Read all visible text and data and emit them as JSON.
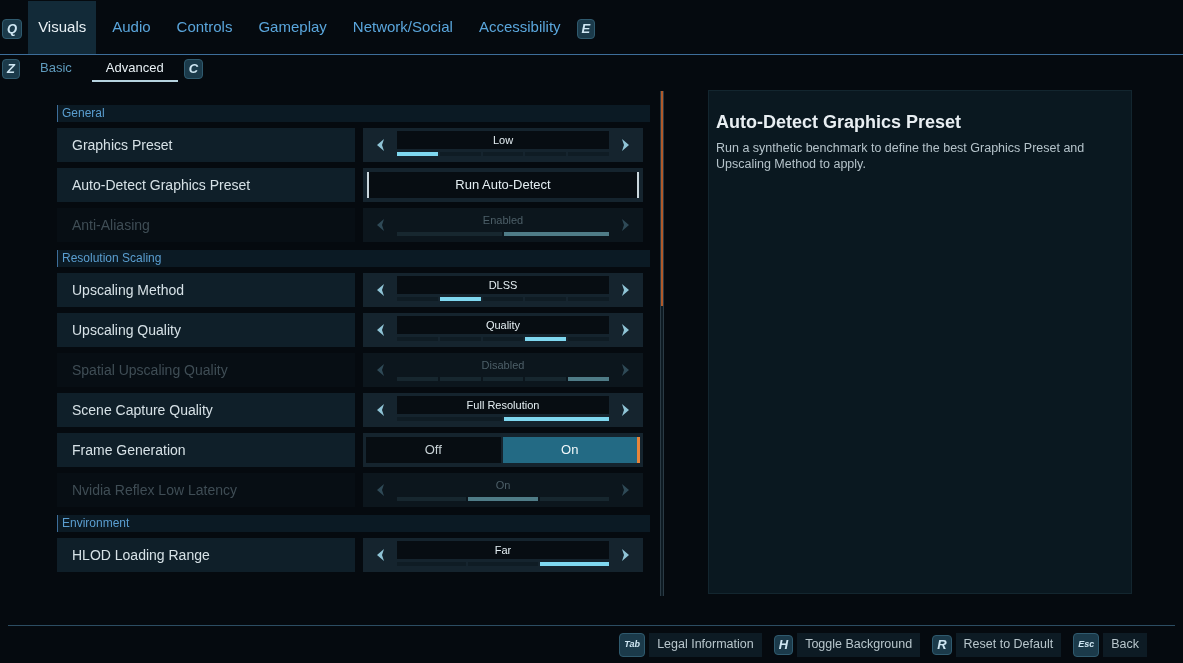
{
  "tabs_key_left": "Q",
  "tabs": [
    {
      "label": "Visuals",
      "selected": true
    },
    {
      "label": "Audio",
      "selected": false
    },
    {
      "label": "Controls",
      "selected": false
    },
    {
      "label": "Gameplay",
      "selected": false
    },
    {
      "label": "Network/Social",
      "selected": false
    },
    {
      "label": "Accessibility",
      "selected": false
    }
  ],
  "tabs_key_right": "E",
  "subtabs_key_left": "Z",
  "subtabs": [
    {
      "label": "Basic",
      "selected": false
    },
    {
      "label": "Advanced",
      "selected": true
    }
  ],
  "subtabs_key_right": "C",
  "sections": [
    {
      "title": "General",
      "settings": [
        {
          "kind": "selector",
          "label": "Graphics Preset",
          "value": "Low",
          "segments": [
            {
              "selected": true
            },
            {
              "selected": false
            },
            {
              "selected": false
            },
            {
              "selected": false
            },
            {
              "selected": false
            }
          ],
          "disabled": false
        },
        {
          "kind": "button",
          "label": "Auto-Detect Graphics Preset",
          "value": "Run Auto-Detect",
          "disabled": false
        },
        {
          "kind": "selector",
          "label": "Anti-Aliasing",
          "value": "Enabled",
          "segments": [
            {
              "selected": false
            },
            {
              "selected": true
            }
          ],
          "disabled": true
        }
      ]
    },
    {
      "title": "Resolution Scaling",
      "settings": [
        {
          "kind": "selector",
          "label": "Upscaling Method",
          "value": "DLSS",
          "segments": [
            {
              "selected": false
            },
            {
              "selected": true
            },
            {
              "selected": false
            },
            {
              "selected": false
            },
            {
              "selected": false
            }
          ],
          "disabled": false
        },
        {
          "kind": "selector",
          "label": "Upscaling Quality",
          "value": "Quality",
          "segments": [
            {
              "selected": false
            },
            {
              "selected": false
            },
            {
              "selected": false
            },
            {
              "selected": true
            },
            {
              "selected": false
            }
          ],
          "disabled": false
        },
        {
          "kind": "selector",
          "label": "Spatial Upscaling Quality",
          "value": "Disabled",
          "segments": [
            {
              "selected": false
            },
            {
              "selected": false
            },
            {
              "selected": false
            },
            {
              "selected": false
            },
            {
              "selected": true
            }
          ],
          "disabled": true
        },
        {
          "kind": "selector",
          "label": "Scene Capture Quality",
          "value": "Full Resolution",
          "segments": [
            {
              "selected": false
            },
            {
              "selected": true
            }
          ],
          "disabled": false
        },
        {
          "kind": "toggle",
          "label": "Frame Generation",
          "options": [
            {
              "label": "Off",
              "selected": false
            },
            {
              "label": "On",
              "selected": true
            }
          ],
          "disabled": false
        },
        {
          "kind": "selector",
          "label": "Nvidia Reflex Low Latency",
          "value": "On",
          "segments": [
            {
              "selected": false
            },
            {
              "selected": true
            },
            {
              "selected": false
            }
          ],
          "disabled": true
        }
      ]
    },
    {
      "title": "Environment",
      "settings": [
        {
          "kind": "selector",
          "label": "HLOD Loading Range",
          "value": "Far",
          "segments": [
            {
              "selected": false
            },
            {
              "selected": false
            },
            {
              "selected": true
            }
          ],
          "disabled": false
        }
      ]
    }
  ],
  "details": {
    "title": "Auto-Detect Graphics Preset",
    "text": "Run a synthetic benchmark to define the best Graphics Preset and Upscaling Method to apply."
  },
  "footer": [
    {
      "key": "Tab",
      "label": "Legal Information"
    },
    {
      "key": "H",
      "label": "Toggle Background"
    },
    {
      "key": "R",
      "label": "Reset to Default"
    },
    {
      "key": "Esc",
      "label": "Back"
    }
  ]
}
